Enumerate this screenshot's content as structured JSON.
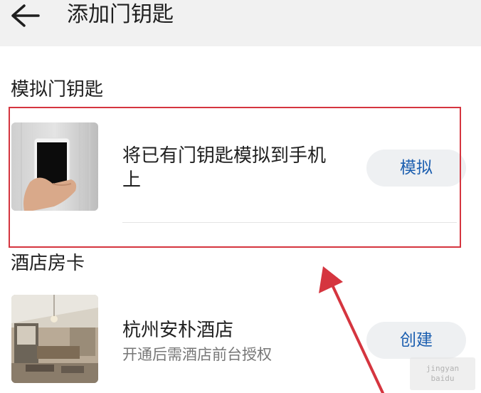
{
  "header": {
    "title": "添加门钥匙",
    "back_icon": "arrow-left-icon"
  },
  "sections": {
    "simulate": {
      "title": "模拟门钥匙",
      "item": {
        "text_line1": "将已有门钥匙模拟到手机",
        "text_line2": "上",
        "button_label": "模拟",
        "thumbnail": "hand-holding-phone"
      }
    },
    "hotel": {
      "title": "酒店房卡",
      "item": {
        "name": "杭州安朴酒店",
        "subtitle": "开通后需酒店前台授权",
        "button_label": "创建",
        "thumbnail": "hotel-room-photo"
      }
    }
  },
  "annotations": {
    "highlight_color": "#d5353f",
    "arrow_color": "#d5353f"
  },
  "watermark": {
    "line1": "jingyan",
    "line2": "baidu"
  },
  "colors": {
    "accent": "#1c5fb0",
    "header_bg": "#f1f1f1",
    "button_bg": "#eef0f2"
  }
}
